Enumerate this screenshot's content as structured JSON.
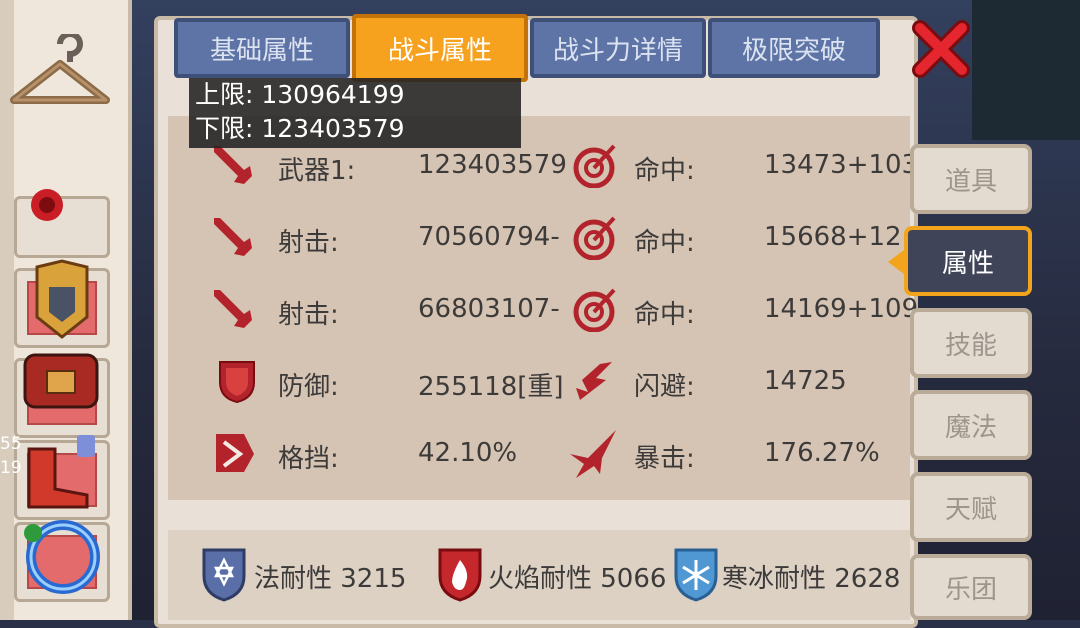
{
  "tabs": [
    {
      "label": "基础属性",
      "active": false
    },
    {
      "label": "战斗属性",
      "active": true
    },
    {
      "label": "战斗力详情",
      "active": false
    },
    {
      "label": "极限突破",
      "active": false
    }
  ],
  "tooltip": {
    "upper": "上限: 130964199",
    "lower": "下限: 123403579"
  },
  "stats": [
    {
      "icon": "sword-icon",
      "label": "武器1:",
      "value": "123403579",
      "icon2": "target-icon",
      "label2": "命中:",
      "value2": "13473+103"
    },
    {
      "icon": "sword-icon",
      "label": "射击:",
      "value": "70560794-",
      "icon2": "target-icon",
      "label2": "命中:",
      "value2": "15668+12"
    },
    {
      "icon": "sword-icon",
      "label": "射击:",
      "value": "66803107-",
      "icon2": "target-icon",
      "label2": "命中:",
      "value2": "14169+109"
    },
    {
      "icon": "shield-icon",
      "label": "防御:",
      "value": "255118[重]",
      "icon2": "dodge-arrow-icon",
      "label2": "闪避:",
      "value2": "14725"
    },
    {
      "icon": "block-icon",
      "label": "格挡:",
      "value": "42.10%",
      "icon2": "critical-icon",
      "label2": "暴击:",
      "value2": "176.27%"
    }
  ],
  "resistances": [
    {
      "icon": "magic-resist-icon",
      "text": "法耐性 3215",
      "color": "#5a6fa8"
    },
    {
      "icon": "fire-resist-icon",
      "text": "火焰耐性 5066",
      "color": "#c4282d"
    },
    {
      "icon": "ice-resist-icon",
      "text": "寒冰耐性 2628",
      "color": "#4f98d4"
    }
  ],
  "side_menu": [
    {
      "label": "道具",
      "active": false
    },
    {
      "label": "属性",
      "active": true
    },
    {
      "label": "技能",
      "active": false
    },
    {
      "label": "魔法",
      "active": false
    },
    {
      "label": "天赋",
      "active": false
    },
    {
      "label": "乐团",
      "active": false
    }
  ],
  "left_numbers": [
    "55",
    "19"
  ],
  "colors": {
    "accent": "#f6a21f",
    "tab": "#5e74a6",
    "icon_red": "#b3232b",
    "panel": "#e9e1d7"
  }
}
